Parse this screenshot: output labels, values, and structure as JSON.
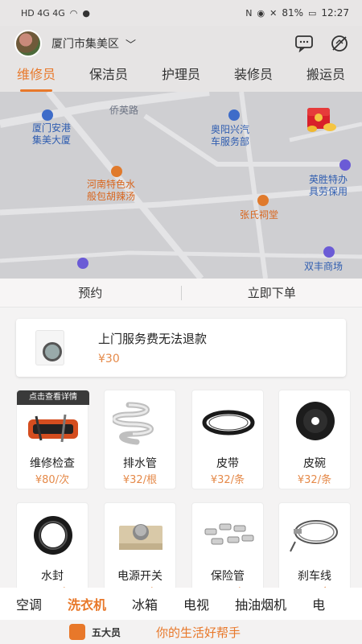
{
  "status_bar": {
    "left_text": "HD 4G 4G",
    "battery": "81%",
    "time": "12:27"
  },
  "header": {
    "location": "厦门市集美区",
    "chat_icon": "chat-bubble-icon",
    "map_off_icon": "map-off-icon"
  },
  "category_tabs": [
    {
      "label": "维修员",
      "active": true
    },
    {
      "label": "保洁员",
      "active": false
    },
    {
      "label": "护理员",
      "active": false
    },
    {
      "label": "装修员",
      "active": false
    },
    {
      "label": "搬运员",
      "active": false
    }
  ],
  "map": {
    "road_label": "侨英路",
    "pois": [
      {
        "text": "厦门安港\n集美大厦",
        "color": "blue"
      },
      {
        "text": "奥阳兴汽\n车服务部",
        "color": "blue"
      },
      {
        "text": "河南特色水\n般包胡辣汤",
        "color": "orange"
      },
      {
        "text": "英胜特办\n具劳保用",
        "color": "blue"
      },
      {
        "text": "张氏祠堂",
        "color": "orange"
      },
      {
        "text": "双丰商场",
        "color": "blue"
      }
    ]
  },
  "order_bar": {
    "reserve": "预约",
    "order_now": "立即下单"
  },
  "notice": {
    "title": "上门服务费无法退款",
    "price": "¥30"
  },
  "products": [
    {
      "name": "维修检查",
      "price": "¥80/次",
      "tag": "点击查看详情"
    },
    {
      "name": "排水管",
      "price": "¥32/根"
    },
    {
      "name": "皮带",
      "price": "¥32/条"
    },
    {
      "name": "皮碗",
      "price": "¥32/条"
    },
    {
      "name": "水封",
      "price": "¥32/个"
    },
    {
      "name": "电源开关",
      "price": "¥32/个"
    },
    {
      "name": "保险管",
      "price": "¥32/个"
    },
    {
      "name": "刹车线",
      "price": "¥32/条"
    }
  ],
  "bottom_tabs": [
    {
      "label": "空调",
      "active": false
    },
    {
      "label": "洗衣机",
      "active": true
    },
    {
      "label": "冰箱",
      "active": false
    },
    {
      "label": "电视",
      "active": false
    },
    {
      "label": "抽油烟机",
      "active": false
    },
    {
      "label": "电",
      "active": false
    }
  ],
  "footer": {
    "brand": "五大员",
    "slogan": "你的生活好帮手"
  },
  "colors": {
    "accent": "#e8782a",
    "price": "#e58a4a"
  }
}
